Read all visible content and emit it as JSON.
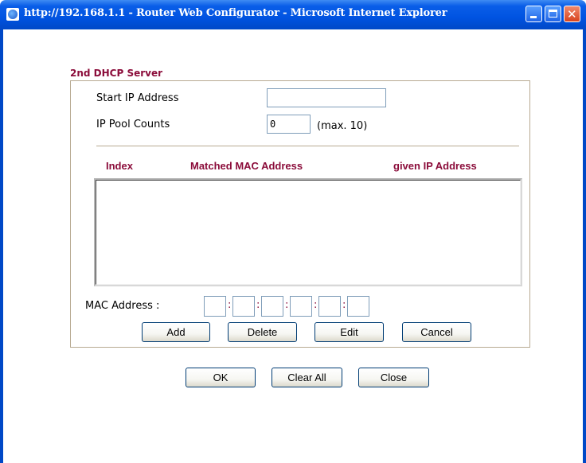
{
  "window": {
    "title": "http://192.168.1.1 - Router Web Configurator - Microsoft Internet Explorer"
  },
  "form": {
    "section_title": "2nd DHCP Server",
    "start_ip_label": "Start IP Address",
    "start_ip_value": "",
    "ip_pool_label": "IP Pool Counts",
    "ip_pool_value": "0",
    "ip_pool_hint": "(max. 10)",
    "columns": [
      "Index",
      "Matched MAC Address",
      "given IP Address"
    ],
    "list_items": [],
    "mac_label": "MAC Address :",
    "mac_separator": ":",
    "mac_octets": [
      "",
      "",
      "",
      "",
      "",
      ""
    ],
    "buttons": {
      "add": "Add",
      "delete": "Delete",
      "edit": "Edit",
      "cancel": "Cancel"
    }
  },
  "footer_buttons": {
    "ok": "OK",
    "clear_all": "Clear All",
    "close": "Close"
  },
  "colors": {
    "title_bar": "#0053e1",
    "accent_text": "#8b0c3a",
    "panel_border": "#b8aa92"
  }
}
